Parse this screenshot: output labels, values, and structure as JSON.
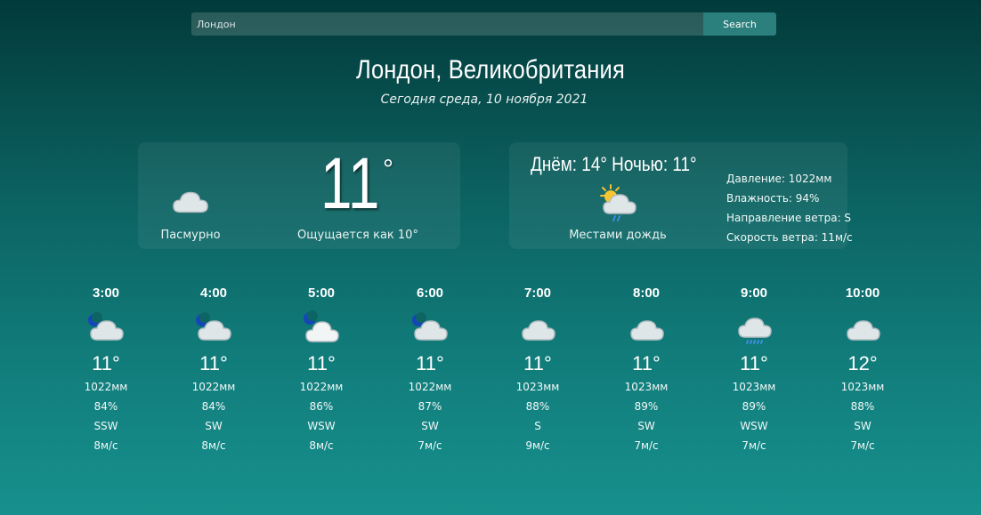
{
  "search": {
    "value": "Лондон",
    "placeholder": "Лондон",
    "button_label": "Search"
  },
  "header": {
    "city": "Лондон, Великобритания",
    "date": "Сегодня среда, 10 ноября 2021"
  },
  "current": {
    "icon": "cloud-icon",
    "condition": "Пасмурно",
    "temp": "11",
    "deg": "°",
    "feels_like": "Ощущается как 10°"
  },
  "forecast": {
    "day_night": "Днём: 14°  Ночью: 11°",
    "icon": "sun-cloud-rain-icon",
    "condition": "Местами дождь",
    "details": [
      "Давление: 1022мм",
      "Влажность: 94%",
      "Направление ветра: S",
      "Скорость ветра: 11м/с"
    ]
  },
  "hourly": [
    {
      "time": "3:00",
      "icon": "moon-cloud-icon",
      "temp": "11°",
      "pressure": "1022мм",
      "humidity": "84%",
      "wind_dir": "SSW",
      "wind_speed": "8м/с"
    },
    {
      "time": "4:00",
      "icon": "moon-cloud-icon",
      "temp": "11°",
      "pressure": "1022мм",
      "humidity": "84%",
      "wind_dir": "SW",
      "wind_speed": "8м/с"
    },
    {
      "time": "5:00",
      "icon": "moon-cloud-icon",
      "temp": "11°",
      "pressure": "1022мм",
      "humidity": "86%",
      "wind_dir": "WSW",
      "wind_speed": "8м/с"
    },
    {
      "time": "6:00",
      "icon": "moon-cloud-icon",
      "temp": "11°",
      "pressure": "1022мм",
      "humidity": "87%",
      "wind_dir": "SW",
      "wind_speed": "7м/с"
    },
    {
      "time": "7:00",
      "icon": "cloud-icon",
      "temp": "11°",
      "pressure": "1023мм",
      "humidity": "88%",
      "wind_dir": "S",
      "wind_speed": "9м/с"
    },
    {
      "time": "8:00",
      "icon": "cloud-icon",
      "temp": "11°",
      "pressure": "1023мм",
      "humidity": "89%",
      "wind_dir": "SW",
      "wind_speed": "7м/с"
    },
    {
      "time": "9:00",
      "icon": "cloud-rain-icon",
      "temp": "11°",
      "pressure": "1023мм",
      "humidity": "89%",
      "wind_dir": "WSW",
      "wind_speed": "7м/с"
    },
    {
      "time": "10:00",
      "icon": "cloud-icon",
      "temp": "12°",
      "pressure": "1023мм",
      "humidity": "88%",
      "wind_dir": "SW",
      "wind_speed": "7м/с"
    }
  ],
  "colors": {
    "background_top": "#023a3a",
    "background_bottom": "#17908d",
    "search_button": "#2b7f7d",
    "text": "#ffffff"
  }
}
